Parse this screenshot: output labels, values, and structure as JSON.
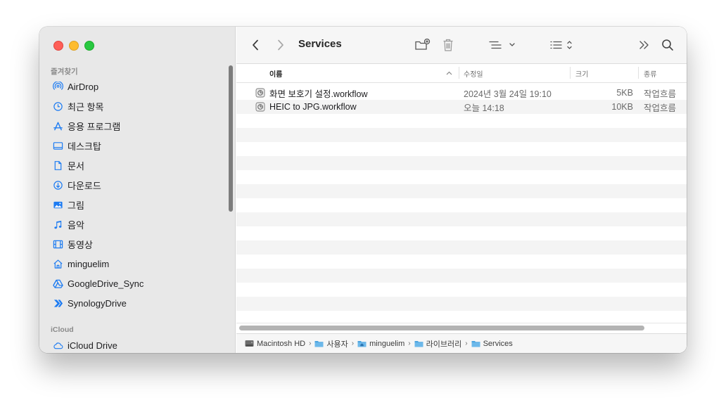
{
  "window": {
    "title": "Services"
  },
  "sidebar": {
    "favorites_header": "즐겨찾기",
    "icloud_header": "iCloud",
    "items": [
      {
        "label": "AirDrop",
        "icon": "airdrop-icon"
      },
      {
        "label": "최근 항목",
        "icon": "clock-icon"
      },
      {
        "label": "응용 프로그램",
        "icon": "applications-icon"
      },
      {
        "label": "데스크탑",
        "icon": "desktop-icon"
      },
      {
        "label": "문서",
        "icon": "document-icon"
      },
      {
        "label": "다운로드",
        "icon": "download-icon"
      },
      {
        "label": "그림",
        "icon": "photo-icon"
      },
      {
        "label": "음악",
        "icon": "music-icon"
      },
      {
        "label": "동영상",
        "icon": "film-icon"
      },
      {
        "label": "minguelim",
        "icon": "home-icon"
      },
      {
        "label": "GoogleDrive_Sync",
        "icon": "google-drive-icon"
      },
      {
        "label": "SynologyDrive",
        "icon": "synology-drive-icon"
      }
    ],
    "icloud_items": [
      {
        "label": "iCloud Drive",
        "icon": "icloud-icon"
      }
    ]
  },
  "columns": {
    "name": "이름",
    "modified": "수정일",
    "size": "크기",
    "kind": "종류"
  },
  "files": [
    {
      "name": "화면 보호기 설정.workflow",
      "modified": "2024년 3월 24일 19:10",
      "size": "5KB",
      "kind": "작업흐름"
    },
    {
      "name": "HEIC to JPG.workflow",
      "modified": "오늘 14:18",
      "size": "10KB",
      "kind": "작업흐름"
    }
  ],
  "pathbar": [
    "Macintosh HD",
    "사용자",
    "minguelim",
    "라이브러리",
    "Services"
  ],
  "colors": {
    "accent": "#1e7cf2",
    "folder": "#4aa3df",
    "red": "#fe5f57",
    "yellow": "#febc2e",
    "green": "#28c840"
  }
}
